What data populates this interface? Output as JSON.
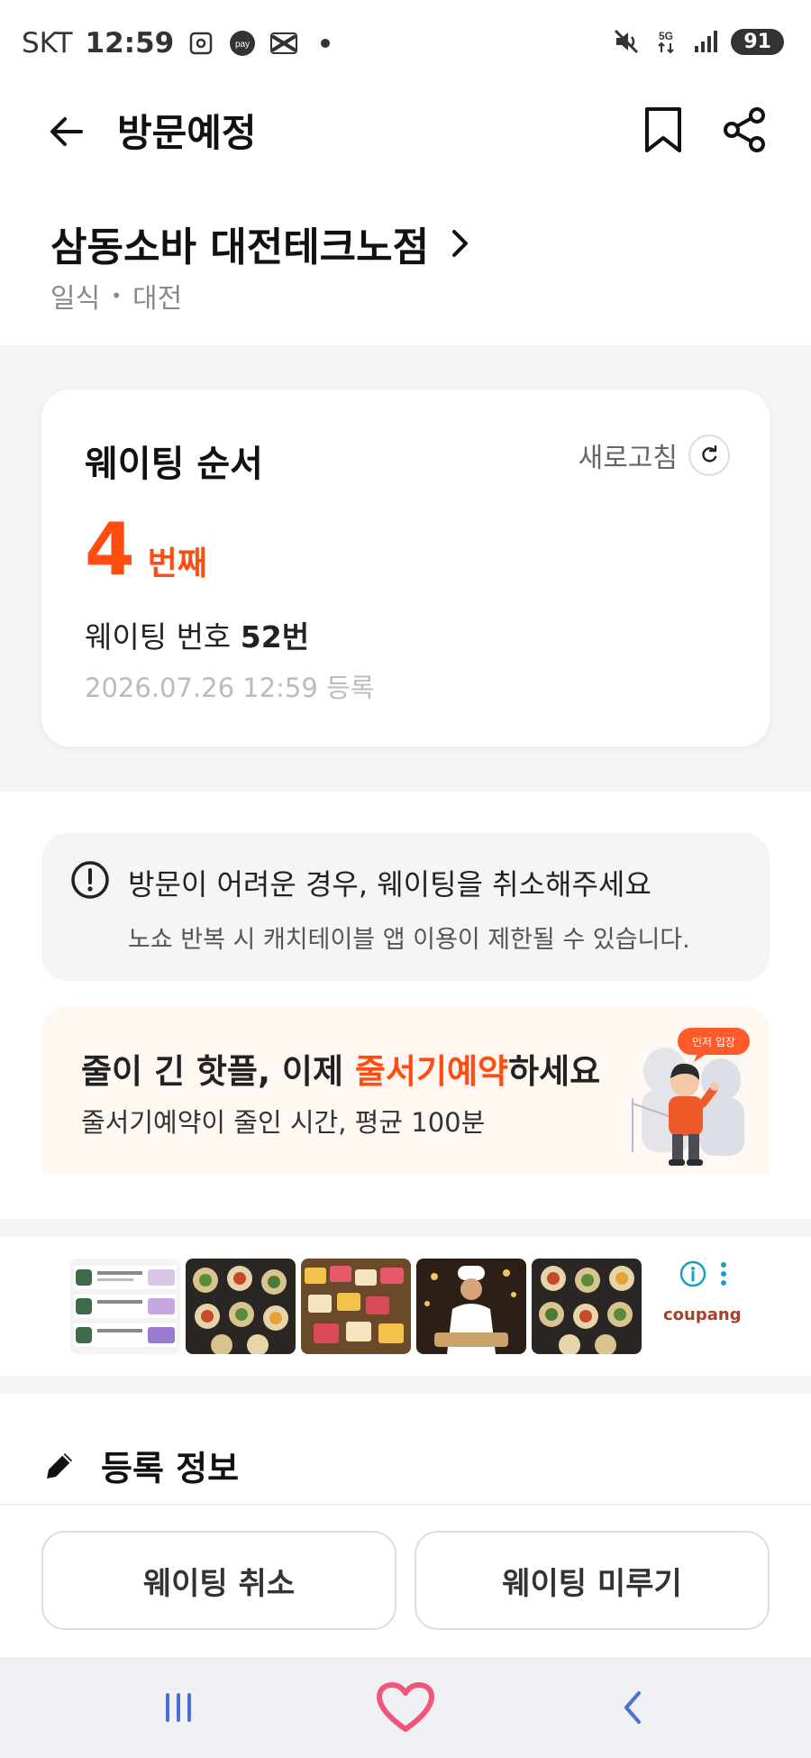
{
  "status_bar": {
    "carrier": "SKT",
    "time": "12:59",
    "network": "5G",
    "battery": "91"
  },
  "header": {
    "title": "방문예정"
  },
  "store": {
    "name": "삼동소바 대전테크노점",
    "category": "일식",
    "region": "대전"
  },
  "waiting": {
    "title": "웨이팅 순서",
    "refresh_label": "새로고침",
    "order_number": "4",
    "order_unit": "번째",
    "number_label": "웨이팅 번호",
    "number_value": "52번",
    "registered_at": "2026.07.26 12:59 등록"
  },
  "notice": {
    "title": "방문이 어려운 경우, 웨이팅을 취소해주세요",
    "subtitle": "노쇼 반복 시 캐치테이블 앱 이용이 제한될 수 있습니다."
  },
  "promo": {
    "title_prefix": "줄이 긴 핫플, 이제 ",
    "title_highlight": "줄서기예약",
    "title_suffix": "하세요",
    "subtitle": "줄서기예약이 줄인 시간, 평균 100분",
    "badge": "먼저 입장"
  },
  "ad": {
    "brand": "coupang"
  },
  "registration": {
    "title": "등록 정보"
  },
  "actions": {
    "cancel_label": "웨이팅 취소",
    "postpone_label": "웨이팅 미루기"
  },
  "colors": {
    "accent": "#ff4d12",
    "gray_bg": "#f4f5f7",
    "promo_bg": "#fff7f1",
    "nav_blue": "#4a6fd6",
    "heart_pink": "#f0567a"
  },
  "icons": {
    "back": "arrow-left-icon",
    "bookmark": "bookmark-icon",
    "share": "share-icon",
    "store_link": "chevron-right-icon",
    "refresh": "refresh-icon",
    "notice": "exclamation-circle-icon",
    "registration": "pencil-icon",
    "ad_info": "info-icon",
    "ad_menu": "more-vertical-icon",
    "nav_recent": "recent-apps-icon",
    "nav_home": "heart-home-icon",
    "nav_back": "nav-back-icon"
  }
}
